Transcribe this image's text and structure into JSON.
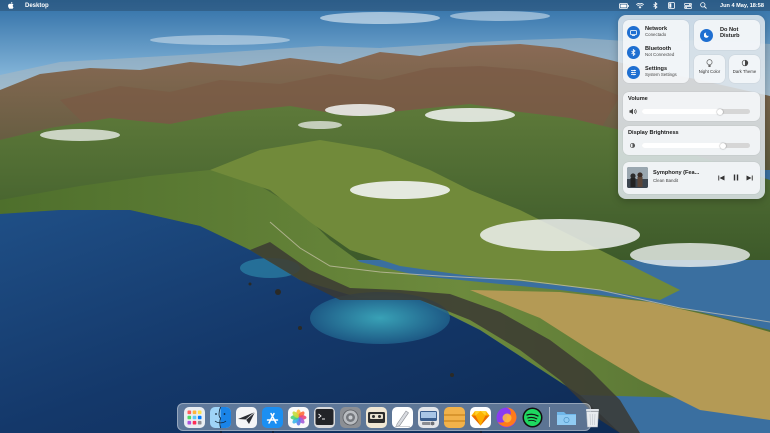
{
  "menubar": {
    "app_title": "Desktop",
    "clock": "Jun 4 May, 18:58",
    "icons": [
      "battery-icon",
      "wifi-icon",
      "bluetooth-icon",
      "sidebar-icon",
      "control-center-icon",
      "search-icon"
    ]
  },
  "control_center": {
    "network": {
      "title": "Network",
      "subtitle": "Conectado"
    },
    "bluetooth": {
      "title": "Bluetooth",
      "subtitle": "Not Connected"
    },
    "settings": {
      "title": "Settings",
      "subtitle": "System Settings"
    },
    "do_not_disturb": {
      "label": "Do Not Disturb"
    },
    "night_color": {
      "label": "Night Color"
    },
    "dark_theme": {
      "label": "Dark Theme"
    },
    "volume": {
      "title": "Volume",
      "level": 0.72
    },
    "brightness": {
      "title": "Display Brightness",
      "level": 0.75
    },
    "media": {
      "title": "Symphony (Fea...",
      "artist": "Clean Bandit"
    }
  },
  "dock": {
    "items": [
      {
        "name": "launchpad-icon",
        "running": false
      },
      {
        "name": "finder-icon",
        "running": true
      },
      {
        "name": "mail-icon",
        "running": false
      },
      {
        "name": "app-store-icon",
        "running": true
      },
      {
        "name": "photos-icon",
        "running": false
      },
      {
        "name": "terminal-icon",
        "running": false
      },
      {
        "name": "system-settings-icon",
        "running": false
      },
      {
        "name": "cassette-icon",
        "running": false
      },
      {
        "name": "text-editor-icon",
        "running": false
      },
      {
        "name": "disk-utility-icon",
        "running": false
      },
      {
        "name": "archive-icon",
        "running": false
      },
      {
        "name": "sketch-icon",
        "running": true
      },
      {
        "name": "firefox-icon",
        "running": false
      },
      {
        "name": "spotify-icon",
        "running": false
      },
      {
        "name": "downloads-folder-icon",
        "running": false
      },
      {
        "name": "trash-icon",
        "running": false
      }
    ]
  },
  "colors": {
    "accent": "#1f6fd1",
    "menubar_text": "#ffffff"
  }
}
